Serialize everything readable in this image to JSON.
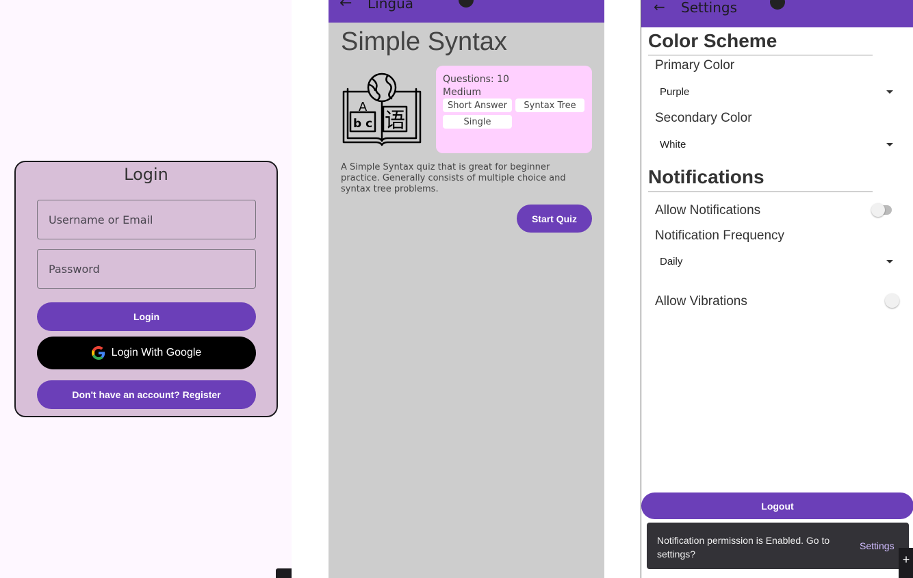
{
  "login": {
    "title": "Login",
    "username_placeholder": "Username or Email",
    "password_placeholder": "Password",
    "login_button": "Login",
    "google_button": "Login With Google",
    "register_button": "Don't have an account? Register"
  },
  "quiz": {
    "appbar_title": "Lingua",
    "title": "Simple Syntax",
    "questions": "Questions: 10",
    "difficulty": "Medium",
    "tags": [
      "Short Answer",
      "Syntax Tree",
      "Single"
    ],
    "description": "A Simple Syntax quiz that is great for beginner practice. Generally consists of multiple choice and syntax tree problems.",
    "start_button": "Start Quiz",
    "image_letters": {
      "a": "A",
      "bc": "b c",
      "hanzi": "语"
    }
  },
  "settings": {
    "appbar_title": "Settings",
    "color_scheme_heading": "Color Scheme",
    "primary_color_label": "Primary Color",
    "primary_color_value": "Purple",
    "secondary_color_label": "Secondary Color",
    "secondary_color_value": "White",
    "notifications_heading": "Notifications",
    "allow_notifications_label": "Allow Notifications",
    "allow_notifications_on": false,
    "frequency_label": "Notification Frequency",
    "frequency_value": "Daily",
    "allow_vibrations_label": "Allow Vibrations",
    "allow_vibrations_on": false,
    "logout_button": "Logout",
    "snackbar_text": "Notification permission is Enabled. Go to settings?",
    "snackbar_action": "Settings"
  },
  "colors": {
    "primary": "#6b3fb8",
    "login_card": "#d8bfd8",
    "quiz_bg": "#cdcdcd",
    "info_card": "#ffd0ff",
    "snackbar": "#333237"
  },
  "icons": [
    "back-arrow-icon",
    "google-g-icon",
    "chevron-down-icon",
    "plus-icon",
    "book-globe-icon"
  ]
}
